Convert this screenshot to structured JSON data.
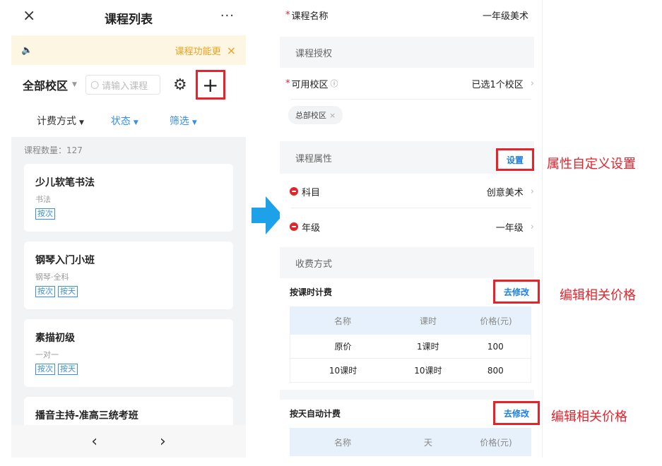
{
  "left": {
    "title": "课程列表",
    "close_icon": "×",
    "more_icon": "···",
    "notice": {
      "speaker_icon": "🔈",
      "text": "课程功能更",
      "close": "×"
    },
    "campus": "全部校区",
    "search_placeholder": "请输入课程",
    "gear_icon": "⚙",
    "add_icon": "+",
    "filters": [
      {
        "label": "计费方式",
        "icon": "▼"
      },
      {
        "label": "状态",
        "icon": "▼"
      },
      {
        "label": "筛选",
        "icon": "▼"
      }
    ],
    "count_text": "课程数量：127",
    "courses": [
      {
        "name": "少儿软笔书法",
        "sub": "书法",
        "tags": [
          "按次"
        ]
      },
      {
        "name": "钢琴入门小班",
        "sub": "钢琴·全科",
        "tags": [
          "按次",
          "按天"
        ]
      },
      {
        "name": "素描初级",
        "sub": "一对一",
        "tags": [
          "按次",
          "按天"
        ]
      },
      {
        "name": "播音主持-准高三统考班",
        "sub": "",
        "tags": []
      }
    ],
    "footer": {
      "prev": "‹",
      "next": "›"
    }
  },
  "right": {
    "course_name": {
      "label": "课程名称",
      "value": "一年级美术"
    },
    "sections": {
      "auth": "课程授权",
      "attrs": "课程属性",
      "fees": "收费方式"
    },
    "campus_row": {
      "label": "可用校区",
      "help_icon": "ⓘ",
      "value": "已选1个校区"
    },
    "campus_chip": {
      "label": "总部校区",
      "x": "×"
    },
    "attr_button": "设置",
    "subject": {
      "label": "科目",
      "value": "创意美术"
    },
    "grade": {
      "label": "年级",
      "value": "一年级"
    },
    "per_lesson": {
      "label": "按课时计费",
      "edit": "去修改",
      "headers": [
        "名称",
        "课时",
        "价格(元)"
      ],
      "rows": [
        [
          "原价",
          "1课时",
          "100"
        ],
        [
          "10课时",
          "10课时",
          "800"
        ]
      ]
    },
    "per_day": {
      "label": "按天自动计费",
      "edit": "去修改",
      "headers": [
        "名称",
        "天",
        "价格(元)"
      ]
    },
    "chevron": "›"
  },
  "annotations": {
    "attr_custom": "属性自定义设置",
    "edit_price_1": "编辑相关价格",
    "edit_price_2": "编辑相关价格"
  },
  "colors": {
    "accent_blue": "#3a8ee6",
    "annot_red": "#e5232b",
    "notice_orange": "#f0a020",
    "arrow_blue": "#1da1e8"
  }
}
